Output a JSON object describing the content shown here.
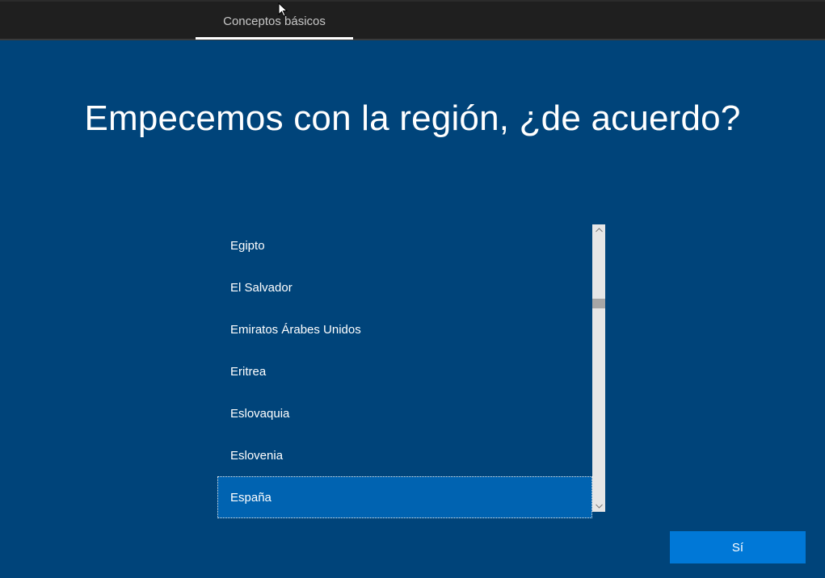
{
  "topbar": {
    "tab_label": "Conceptos básicos"
  },
  "main": {
    "heading": "Empecemos con la región, ¿de acuerdo?",
    "region_list": {
      "items": [
        {
          "label": "Egipto",
          "selected": false
        },
        {
          "label": "El Salvador",
          "selected": false
        },
        {
          "label": "Emiratos Árabes Unidos",
          "selected": false
        },
        {
          "label": "Eritrea",
          "selected": false
        },
        {
          "label": "Eslovaquia",
          "selected": false
        },
        {
          "label": "Eslovenia",
          "selected": false
        },
        {
          "label": "España",
          "selected": true
        }
      ]
    },
    "next_button_label": "Sí"
  },
  "colors": {
    "background": "#00447a",
    "topbar": "#1f1f1f",
    "selected_item": "#0063b1",
    "button": "#0078d7"
  },
  "icons": {
    "scroll_up": "chevron-up-icon",
    "scroll_down": "chevron-down-icon",
    "cursor": "mouse-pointer-icon"
  }
}
